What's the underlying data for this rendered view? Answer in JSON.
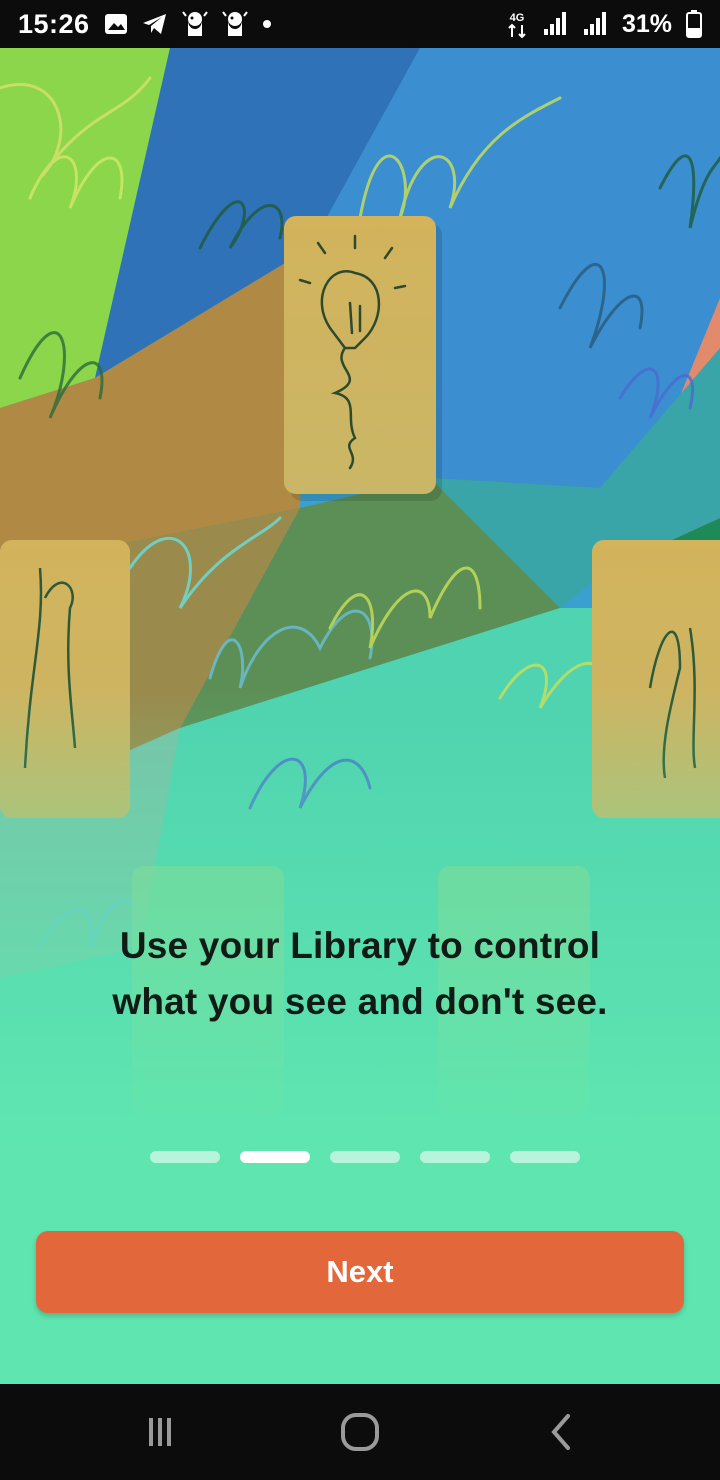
{
  "status_bar": {
    "time": "15:26",
    "network": "4G",
    "battery_percent": "31%",
    "left_icons": [
      "image-icon",
      "telegram-icon",
      "premier-league-icon",
      "premier-league-icon",
      "notification-dot-icon"
    ],
    "right_icons": [
      "signal-icon",
      "signal-icon",
      "battery-icon"
    ]
  },
  "onboarding": {
    "caption_line1": "Use your Library to control",
    "caption_line2": "what you see and don't see.",
    "pages_total": 5,
    "current_page": 2,
    "next_label": "Next"
  },
  "nav_bar": {
    "buttons": [
      "recent-apps-icon",
      "home-icon",
      "back-icon"
    ]
  },
  "colors": {
    "background": "#5fe6b0",
    "button": "#e2683b",
    "text": "#111b16",
    "bars": "#0c0c0c"
  }
}
